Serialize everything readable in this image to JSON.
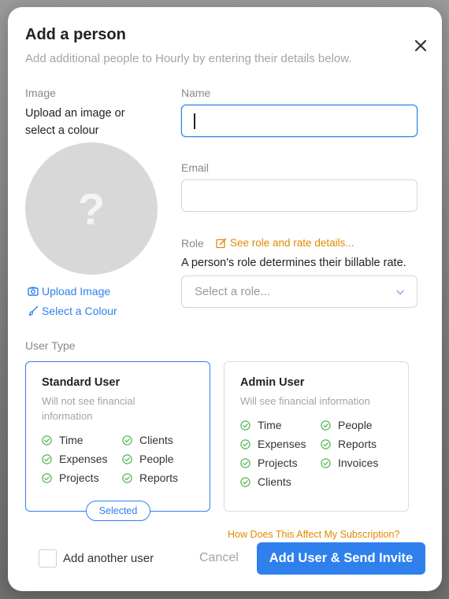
{
  "modal": {
    "title": "Add a person",
    "subtitle": "Add additional people to Hourly by entering their details below."
  },
  "image": {
    "label": "Image",
    "help_line1": "Upload an image or",
    "help_line2": "select a colour",
    "placeholder_glyph": "?",
    "upload_label": "Upload Image",
    "colour_label": "Select a Colour"
  },
  "name": {
    "label": "Name",
    "value": ""
  },
  "email": {
    "label": "Email",
    "value": ""
  },
  "role": {
    "label": "Role",
    "details_link": "See role and rate details...",
    "help": "A person's role determines their billable rate.",
    "placeholder": "Select a role..."
  },
  "user_type": {
    "label": "User Type",
    "standard": {
      "title": "Standard User",
      "desc": "Will not see financial information",
      "features": [
        "Time",
        "Clients",
        "Expenses",
        "People",
        "Projects",
        "Reports"
      ],
      "badge": "Selected"
    },
    "admin": {
      "title": "Admin User",
      "desc": "Will see financial information",
      "features": [
        "Time",
        "People",
        "Expenses",
        "Reports",
        "Projects",
        "Invoices",
        "Clients"
      ]
    }
  },
  "footer": {
    "subscription_link": "How Does This Affect My Subscription?",
    "add_another": "Add another user",
    "cancel": "Cancel",
    "submit": "Add User & Send Invite"
  },
  "colors": {
    "accent": "#2f80ed",
    "link_orange": "#e08a00",
    "check_green": "#5cb85c"
  }
}
